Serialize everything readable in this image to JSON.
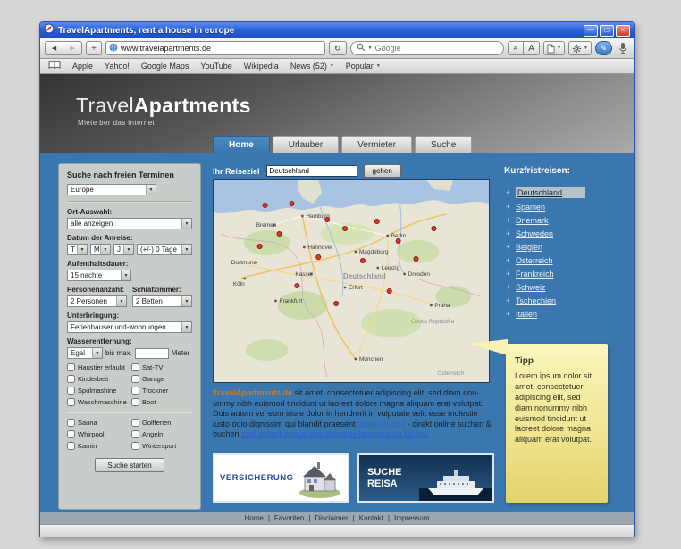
{
  "icons": {
    "minimize": "—",
    "maximize": "□",
    "close": "×",
    "back": "◀",
    "forward": "▶",
    "add_bookmark": "+",
    "refresh": "↻",
    "dropdown": "▼",
    "font_small": "A",
    "font_large": "A",
    "pencil": "✎",
    "plus_bullet": "+"
  },
  "window": {
    "title": "TravelApartments, rent a house in europe"
  },
  "browser": {
    "address": "www.travelapartments.de",
    "search_placeholder": "Google",
    "bookmarks": [
      "Apple",
      "Yahoo!",
      "Google Maps",
      "YouTube",
      "Wikipedia",
      "News (52)",
      "Popular"
    ]
  },
  "site": {
    "logo_part1": "Travel",
    "logo_part2": "Apartments",
    "tagline": "Miete ber das internet",
    "tabs": [
      "Home",
      "Urlauber",
      "Vermieter",
      "Suche"
    ]
  },
  "panel": {
    "title": "Suche nach freien Terminen",
    "region_value": "Europe",
    "ort_label": "Ort-Auswahl:",
    "ort_value": "alle anzeigen",
    "datum_label": "Datum der Anreise:",
    "datum_t": "T",
    "datum_m": "M",
    "datum_j": "J",
    "datum_tage": "(+/-) 0 Tage",
    "dauer_label": "Aufenthaltsdauer:",
    "dauer_value": "15 nachte",
    "personen_label": "Personenanzahl:",
    "personen_value": "2 Personen",
    "schlaf_label": "Schlafzimmer:",
    "schlaf_value": "2 Betten",
    "unterbringung_label": "Unterbringung:",
    "unterbringung_value": "Ferienhauser und-wohnungen",
    "wasser_label": "Wasserentfernung:",
    "wasser_value": "Egal",
    "bis_label": "bis max.",
    "meter_label": "Meter",
    "checks_left": [
      "Haustier erlaubt",
      "Kinderbett",
      "Spulmashine",
      "Waschmaschine",
      "Sauna",
      "Whirpool",
      "Kamin"
    ],
    "checks_right": [
      "Sat-TV",
      "Garage",
      "Trockner",
      "Boot",
      "Golfferien",
      "Angeln",
      "Wintersport"
    ],
    "submit": "Suche starten"
  },
  "dest": {
    "label": "Ihr Reiseziel",
    "value": "Deutschland",
    "button": "gehen"
  },
  "map": {
    "country": "Deutschland",
    "cities": [
      "Hamburg",
      "Bremen",
      "Berlin",
      "Hannover",
      "Magdeburg",
      "Leipzig",
      "Dresden",
      "Kassel",
      "Erfurt",
      "Dortmund",
      "Köln",
      "Frankfurt",
      "Praha",
      "München"
    ],
    "neighbor1": "Ceska Republika",
    "neighbor2": "Österreich"
  },
  "intro": {
    "brand": "TravelApartments.de",
    "text1": " sit amet, consectetuer adipiscing elit, sed diam non-ummy nibh euismod tincidunt ut laoreet dolore magna aliquam erat volutpat. Duis autem vel eum iriure dolor in hendrerit in vulputate velit esse molestie iusto odio dignissim qui blandit praesent ",
    "link1": "luptatum zzril",
    "text2": " - direkt online suchen & buchen ",
    "link2": "zznl delenit augue duis dolore te feugait nulla facilisi."
  },
  "banners": {
    "banner1": "VERSICHERUNG",
    "banner2_line1": "SUCHE",
    "banner2_line2": "REISA"
  },
  "sidebar": {
    "title": "Kurzfristreisen:",
    "items": [
      "Deutschland",
      "Spanien",
      "Dnemark",
      "Schweden",
      "Belgien",
      "Osterreich",
      "Frankreich",
      "Schweiz",
      "Tschechien",
      "Italien"
    ]
  },
  "tipp": {
    "title": "Tipp",
    "text": "Lorem ipsum dolor sit amet, consectetuer adipiscing elit, sed diam nonummy nibh euismod tincidunt ut laoreet dolore magna aliquam erat volutpat."
  },
  "footer": {
    "sep": "|",
    "items": [
      "Home",
      "Favoriten",
      "Disclaimer",
      "Kontakt",
      "Impressum"
    ]
  }
}
